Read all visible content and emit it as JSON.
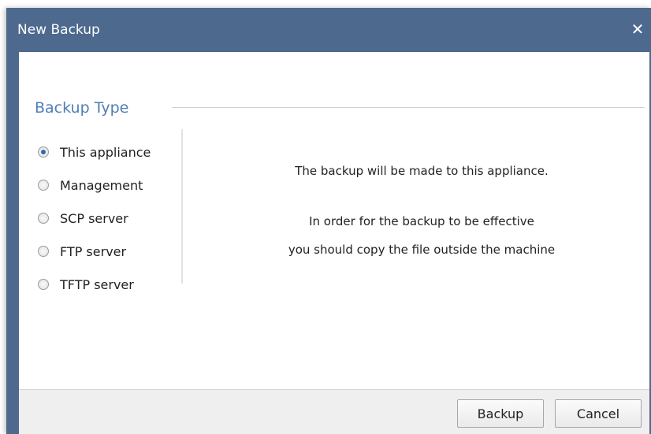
{
  "dialog": {
    "title": "New Backup",
    "close_symbol": "✕"
  },
  "backup_type": {
    "legend": "Backup Type",
    "options": [
      {
        "label": "This appliance",
        "checked": true
      },
      {
        "label": "Management",
        "checked": false
      },
      {
        "label": "SCP server",
        "checked": false
      },
      {
        "label": "FTP server",
        "checked": false
      },
      {
        "label": "TFTP server",
        "checked": false
      }
    ]
  },
  "message": {
    "line1": "The backup will be made to this appliance.",
    "line2": "In order for the backup to be effective",
    "line3": "you should copy the file outside the machine"
  },
  "footer": {
    "backup_label": "Backup",
    "cancel_label": "Cancel"
  },
  "colors": {
    "titlebar": "#4d6a8e",
    "legend": "#4f7eb5",
    "radio_dot": "#2f6cb0"
  }
}
